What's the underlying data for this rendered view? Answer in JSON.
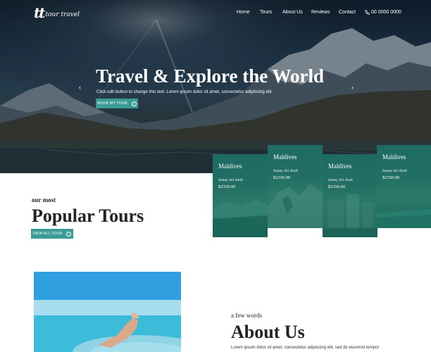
{
  "brand": {
    "mark": "tt",
    "name": "tour travel"
  },
  "nav": {
    "items": [
      "Home",
      "Tours",
      "About Us",
      "Reviews",
      "Contact"
    ],
    "phone": "00 0000 0000"
  },
  "hero": {
    "title": "Travel & Explore the World",
    "subtitle": "Click edit button to change this text. Lorem ipsum dolor sit amet, consectetur adipiscing elit.",
    "button": "BOOK MY TOUR",
    "prev": "‹",
    "next": "›"
  },
  "popular": {
    "kicker": "our most",
    "title": "Popular Tours",
    "button": "VIEW ALL TOUR"
  },
  "tours": [
    {
      "name": "Maldives",
      "location": "Sunny Ari Atoll",
      "price": "$2350.00"
    },
    {
      "name": "Maldives",
      "location": "Sunny Ari Atoll",
      "price": "$2350.00"
    },
    {
      "name": "Maldives",
      "location": "Sunny Ari Atoll",
      "price": "$2350.00"
    },
    {
      "name": "Maldives",
      "location": "Sunny Ari Atoll",
      "price": "$2350.00"
    }
  ],
  "about": {
    "kicker": "a few words",
    "title": "About Us",
    "text": "Lorem ipsum dolor sit amet, consectetur adipiscing elit, sed do eiusmod tempor"
  },
  "colors": {
    "accent": "#3a9c95",
    "card": "#1f6d63",
    "hero_dark": "#1d3347"
  }
}
